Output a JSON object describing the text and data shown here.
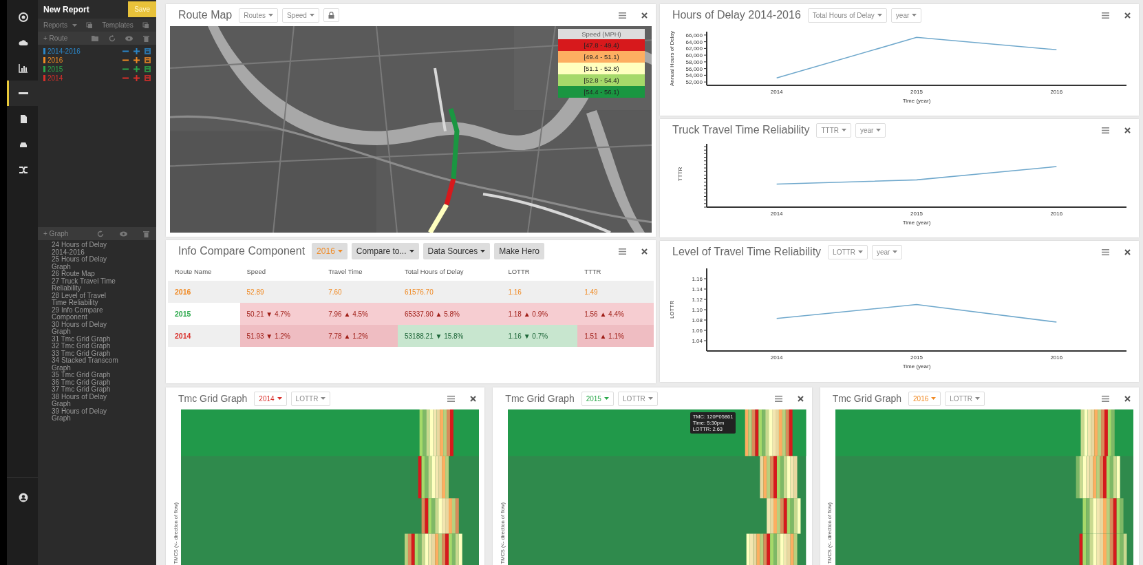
{
  "rail": {
    "icons": [
      {
        "kind": "logo",
        "selected": false
      },
      {
        "kind": "cloud",
        "selected": false
      },
      {
        "kind": "chart",
        "selected": false
      },
      {
        "kind": "route",
        "selected": true
      },
      {
        "kind": "document",
        "selected": false
      },
      {
        "kind": "car",
        "selected": false
      },
      {
        "kind": "shuffle",
        "selected": false
      }
    ],
    "bottom": {
      "kind": "user",
      "selected": false
    }
  },
  "sidebar": {
    "title": "New Report",
    "save": "Save",
    "reports": "Reports",
    "templates": "Templates",
    "add_route": "+ Route",
    "routes": [
      {
        "name": "2014-2016",
        "color": "#2b86c8"
      },
      {
        "name": "2016",
        "color": "#f08a24"
      },
      {
        "name": "2015",
        "color": "#2aa84a"
      },
      {
        "name": "2014",
        "color": "#d9302b"
      }
    ],
    "add_graph": "+ Graph",
    "graphs": [
      "24 Hours of Delay 2014-2016",
      "25 Hours of Delay Graph",
      "26 Route Map",
      "27 Truck Travel Time Reliability",
      "28 Level of Travel Time Reliability",
      "29 Info Compare Component",
      "30 Hours of Delay Graph",
      "31 Tmc Grid Graph",
      "32 Tmc Grid Graph",
      "33 Tmc Grid Graph",
      "34 Stacked Transcom Graph",
      "35 Tmc Grid Graph",
      "36 Tmc Grid Graph",
      "37 Tmc Grid Graph",
      "38 Hours of Delay Graph",
      "39 Hours of Delay Graph"
    ]
  },
  "route_map": {
    "title": "Route Map",
    "dropdowns": [
      "Routes",
      "Speed"
    ],
    "legend": {
      "title": "Speed (MPH)",
      "ranges": [
        {
          "label": "[47.8 - 49.4)",
          "color": "#d7191c"
        },
        {
          "label": "[49.4 - 51.1)",
          "color": "#fdae61"
        },
        {
          "label": "[51.1 - 52.8)",
          "color": "#ffffbf"
        },
        {
          "label": "[52.8 - 54.4)",
          "color": "#a6d96a"
        },
        {
          "label": "[54.4 - 56.1)",
          "color": "#1a9641"
        }
      ]
    }
  },
  "info_compare": {
    "title": "Info Compare Component",
    "year": {
      "label": "2016",
      "color": "#f08a24"
    },
    "buttons": [
      "Compare to...",
      "Data Sources"
    ],
    "hero": "Make Hero",
    "columns": [
      "Route Name",
      "Speed",
      "Travel Time",
      "Total Hours of Delay",
      "LOTTR",
      "TTTR"
    ],
    "rows": [
      {
        "color": "#f08a24",
        "cells": [
          {
            "text": "2016",
            "kind": "plain"
          },
          {
            "text": "52.89",
            "kind": "plain"
          },
          {
            "text": "7.60",
            "kind": "plain"
          },
          {
            "text": "61576.70",
            "kind": "plain"
          },
          {
            "text": "1.16",
            "kind": "plain"
          },
          {
            "text": "1.49",
            "kind": "plain"
          }
        ]
      },
      {
        "color": "#2aa84a",
        "cells": [
          {
            "text": "2015",
            "kind": "plain"
          },
          {
            "text": "50.21 ▼ 4.7%",
            "kind": "worse"
          },
          {
            "text": "7.96 ▲ 4.5%",
            "kind": "worse"
          },
          {
            "text": "65337.90 ▲ 5.8%",
            "kind": "worse"
          },
          {
            "text": "1.18 ▲ 0.9%",
            "kind": "worse"
          },
          {
            "text": "1.56 ▲ 4.4%",
            "kind": "worse"
          }
        ]
      },
      {
        "color": "#d9302b",
        "cells": [
          {
            "text": "2014",
            "kind": "plain"
          },
          {
            "text": "51.93 ▼ 1.2%",
            "kind": "worse"
          },
          {
            "text": "7.78 ▲ 1.2%",
            "kind": "worse"
          },
          {
            "text": "53188.21 ▼ 15.8%",
            "kind": "better"
          },
          {
            "text": "1.16 ▼ 0.7%",
            "kind": "better"
          },
          {
            "text": "1.51 ▲ 1.1%",
            "kind": "worse"
          }
        ]
      }
    ]
  },
  "line_charts": [
    {
      "kind": "chart",
      "title": "Hours of Delay 2014-2016",
      "dropdowns": [
        "Total Hours of Delay",
        "year"
      ],
      "chart_data": {
        "type": "line",
        "xlabel": "Time (year)",
        "ylabel": "Annual Hours of Delay",
        "categories": [
          "2014",
          "2015",
          "2016"
        ],
        "series": [
          {
            "color": "#6fa8cc",
            "values": [
              53200,
              65300,
              61600
            ]
          }
        ],
        "ylim": [
          51000,
          67000
        ],
        "yticks": [
          {
            "value": 52000,
            "label": "52,000"
          },
          {
            "value": 54000,
            "label": "54,000"
          },
          {
            "value": 56000,
            "label": "56,000"
          },
          {
            "value": 58000,
            "label": "58,000"
          },
          {
            "value": 60000,
            "label": "60,000"
          },
          {
            "value": 62000,
            "label": "62,000"
          },
          {
            "value": 64000,
            "label": "64,000"
          },
          {
            "value": 66000,
            "label": "66,000"
          }
        ]
      }
    },
    {
      "kind": "sketch",
      "title": "Truck Travel Time Reliability",
      "dropdowns": [
        "TTTR",
        "year"
      ],
      "ylabel": "TTTR",
      "xticks": [
        "2014",
        "2015",
        "2016"
      ],
      "xlabel": "Time (year)"
    },
    {
      "kind": "chart",
      "title": "Level of Travel Time Reliability",
      "dropdowns": [
        "LOTTR",
        "year"
      ],
      "chart_data": {
        "type": "line",
        "xlabel": "Time (year)",
        "ylabel": "LOTTR",
        "categories": [
          "2014",
          "2015",
          "2016"
        ],
        "series": [
          {
            "color": "#6fa8cc",
            "values": [
              1.083,
              1.11,
              1.076
            ]
          }
        ],
        "ylim": [
          1.02,
          1.18
        ],
        "yticks": [
          {
            "value": 1.04,
            "label": "1.04"
          },
          {
            "value": 1.06,
            "label": "1.06"
          },
          {
            "value": 1.08,
            "label": "1.08"
          },
          {
            "value": 1.1,
            "label": "1.10"
          },
          {
            "value": 1.12,
            "label": "1.12"
          },
          {
            "value": 1.14,
            "label": "1.14"
          },
          {
            "value": 1.16,
            "label": "1.16"
          }
        ]
      }
    }
  ],
  "tmc_grids": [
    {
      "title": "Tmc Grid Graph",
      "year": {
        "label": "2014",
        "color": "#d9302b"
      },
      "measure": "LOTTR",
      "ylabel": "TMCS (<- direction of flow)"
    },
    {
      "title": "Tmc Grid Graph",
      "year": {
        "label": "2015",
        "color": "#2aa84a"
      },
      "measure": "LOTTR",
      "ylabel": "TMCS (<- direction of flow)",
      "tooltip": [
        "TMC: 120P05861",
        "Time: 5:30pm",
        "LOTTR: 2.63"
      ]
    },
    {
      "title": "Tmc Grid Graph",
      "year": {
        "label": "2016",
        "color": "#f08a24"
      },
      "measure": "LOTTR",
      "ylabel": "TMCS (<- direction of flow)"
    }
  ]
}
